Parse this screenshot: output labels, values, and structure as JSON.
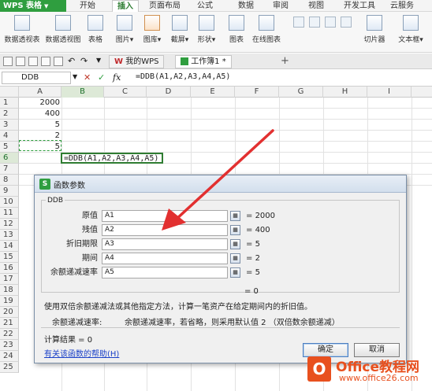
{
  "app": {
    "name": "WPS 表格",
    "accent": "#2f9e3f"
  },
  "ribbon_tabs": [
    {
      "label": "开始"
    },
    {
      "label": "插入",
      "active": true
    },
    {
      "label": "页面布局"
    },
    {
      "label": "公式"
    },
    {
      "label": "数据"
    },
    {
      "label": "审阅"
    },
    {
      "label": "视图"
    },
    {
      "label": "开发工具"
    },
    {
      "label": "云服务"
    }
  ],
  "ribbon_buttons": [
    {
      "label": "数据透视表",
      "icon": "pivot-table-icon"
    },
    {
      "label": "数据透视图",
      "icon": "pivot-chart-icon"
    },
    {
      "label": "表格",
      "icon": "table-icon"
    },
    {
      "label": "图片▾",
      "icon": "picture-icon"
    },
    {
      "label": "图库▾",
      "icon": "gallery-icon"
    },
    {
      "label": "截屏▾",
      "icon": "screenshot-icon"
    },
    {
      "label": "形状▾",
      "icon": "shapes-icon"
    },
    {
      "label": "图表",
      "icon": "chart-icon"
    },
    {
      "label": "在线图表",
      "icon": "online-chart-icon"
    },
    {
      "label": "切片器",
      "icon": "slicer-icon"
    },
    {
      "label": "文本框▾",
      "icon": "textbox-icon"
    }
  ],
  "doc_tabs": [
    {
      "label": "我的WPS",
      "icon": "wps-logo-icon"
    },
    {
      "label": "工作簿1 *",
      "icon": "sheet-icon"
    }
  ],
  "formula_bar": {
    "name_box": "DDB",
    "cancel": "✕",
    "confirm": "✓",
    "fx": "fx",
    "formula": "=DDB(A1,A2,A3,A4,A5)"
  },
  "columns": [
    "A",
    "B",
    "C",
    "D",
    "E",
    "F",
    "G",
    "H",
    "I"
  ],
  "rows": [
    "1",
    "2",
    "3",
    "4",
    "5",
    "6",
    "7",
    "8",
    "9",
    "10",
    "11",
    "12",
    "13",
    "14",
    "15",
    "16",
    "17",
    "18",
    "19",
    "20",
    "21",
    "22",
    "23",
    "24",
    "25"
  ],
  "cells": {
    "A1": "2000",
    "A2": "400",
    "A3": "5",
    "A4": "2",
    "A5": "5",
    "B6": "=DDB(A1,A2,A3,A4,A5)"
  },
  "dialog": {
    "title": "函数参数",
    "function_name": "DDB",
    "args": [
      {
        "label": "原值",
        "ref": "A1",
        "result": "2000"
      },
      {
        "label": "残值",
        "ref": "A2",
        "result": "400"
      },
      {
        "label": "折旧期限",
        "ref": "A3",
        "result": "5"
      },
      {
        "label": "期间",
        "ref": "A4",
        "result": "2"
      },
      {
        "label": "余额递减速率",
        "ref": "A5",
        "result": "5"
      }
    ],
    "total": "= 0",
    "description": "使用双倍余额递减法或其他指定方法，计算一笔资产在给定期间内的折旧值。",
    "arg_help_label": "余额递减速率:",
    "arg_help_text": "余额递减速率，若省略，则采用默认值 2 （双倍数余额递减）",
    "result_text": "计算结果 = 0",
    "help_link": "有关该函数的帮助(H)",
    "ok": "确定",
    "cancel": "取消"
  },
  "watermark": {
    "logo": "O",
    "title": "Office教程网",
    "subtitle": "www.office26.com"
  }
}
